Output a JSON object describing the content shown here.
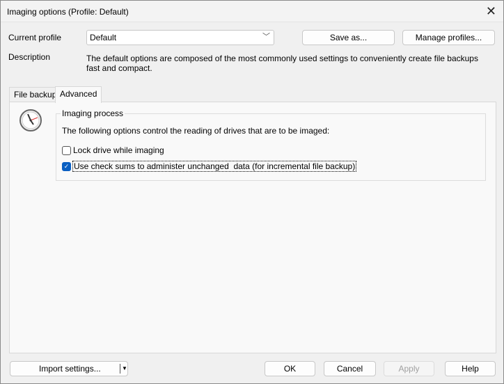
{
  "window": {
    "title": "Imaging options (Profile: Default)",
    "close_icon": "close-icon"
  },
  "profile": {
    "label": "Current profile",
    "value": "Default",
    "save_as": "Save as...",
    "manage": "Manage profiles..."
  },
  "description": {
    "label": "Description",
    "text": "The default options are composed of the most commonly used settings to conveniently create file backups fast and compact."
  },
  "tabs": [
    {
      "label": "File backup",
      "active": false
    },
    {
      "label": "Advanced",
      "active": true
    }
  ],
  "advanced": {
    "icon": "clock-icon",
    "group_title": "Imaging process",
    "intro": "The following options control the reading of drives that are to be imaged:",
    "options": [
      {
        "label": "Lock drive while imaging",
        "checked": false
      },
      {
        "label": "Use check sums to administer unchanged  data (for incremental file backup)",
        "checked": true
      }
    ]
  },
  "footer": {
    "import": "Import settings...",
    "ok": "OK",
    "cancel": "Cancel",
    "apply": "Apply",
    "help": "Help"
  },
  "colors": {
    "accent": "#0a5fc2"
  }
}
